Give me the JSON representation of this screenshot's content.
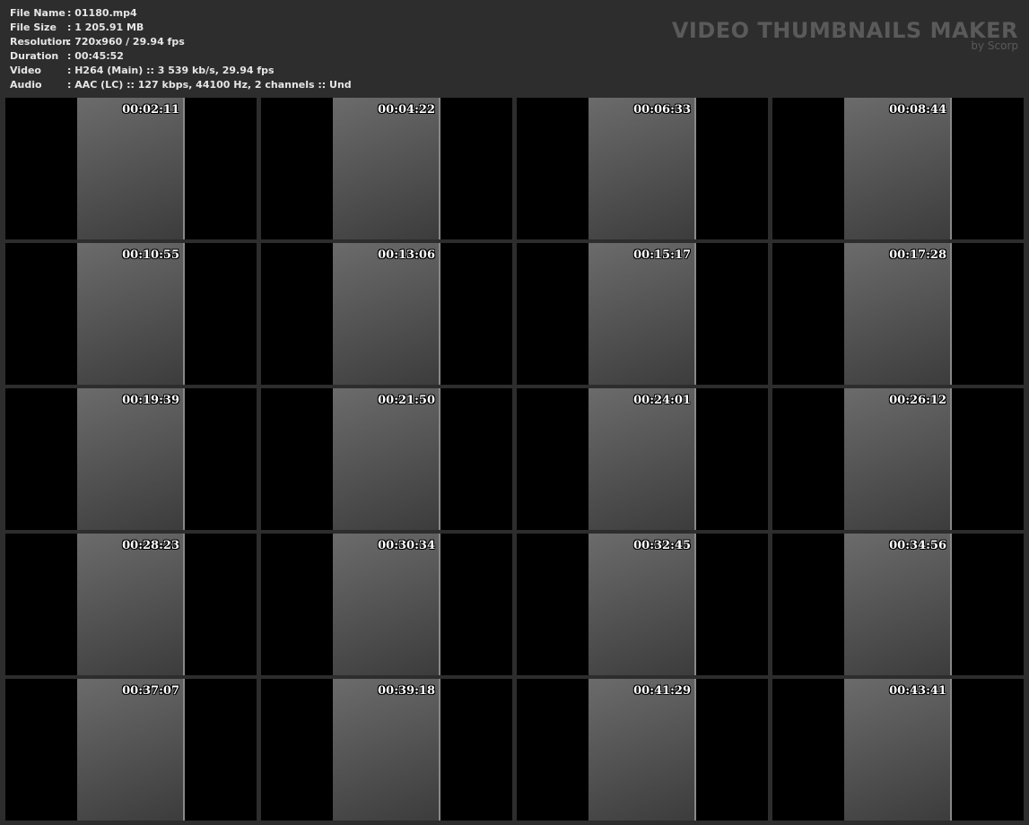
{
  "info": [
    {
      "label": "File Name",
      "value": ": 01180.mp4"
    },
    {
      "label": "File Size",
      "value": ": 1 205.91 MB"
    },
    {
      "label": "Resolution",
      "value": ": 720x960 / 29.94 fps"
    },
    {
      "label": "Duration",
      "value": ": 00:45:52"
    },
    {
      "label": "Video",
      "value": ": H264 (Main) :: 3 539 kb/s, 29.94 fps"
    },
    {
      "label": "Audio",
      "value": ": AAC (LC) :: 127 kbps, 44100 Hz, 2 channels :: Und"
    }
  ],
  "brand": {
    "title": "VIDEO THUMBNAILS MAKER",
    "subtitle": "by Scorp"
  },
  "thumbnails": [
    "00:02:11",
    "00:04:22",
    "00:06:33",
    "00:08:44",
    "00:10:55",
    "00:13:06",
    "00:15:17",
    "00:17:28",
    "00:19:39",
    "00:21:50",
    "00:24:01",
    "00:26:12",
    "00:28:23",
    "00:30:34",
    "00:32:45",
    "00:34:56",
    "00:37:07",
    "00:39:18",
    "00:41:29",
    "00:43:41"
  ]
}
